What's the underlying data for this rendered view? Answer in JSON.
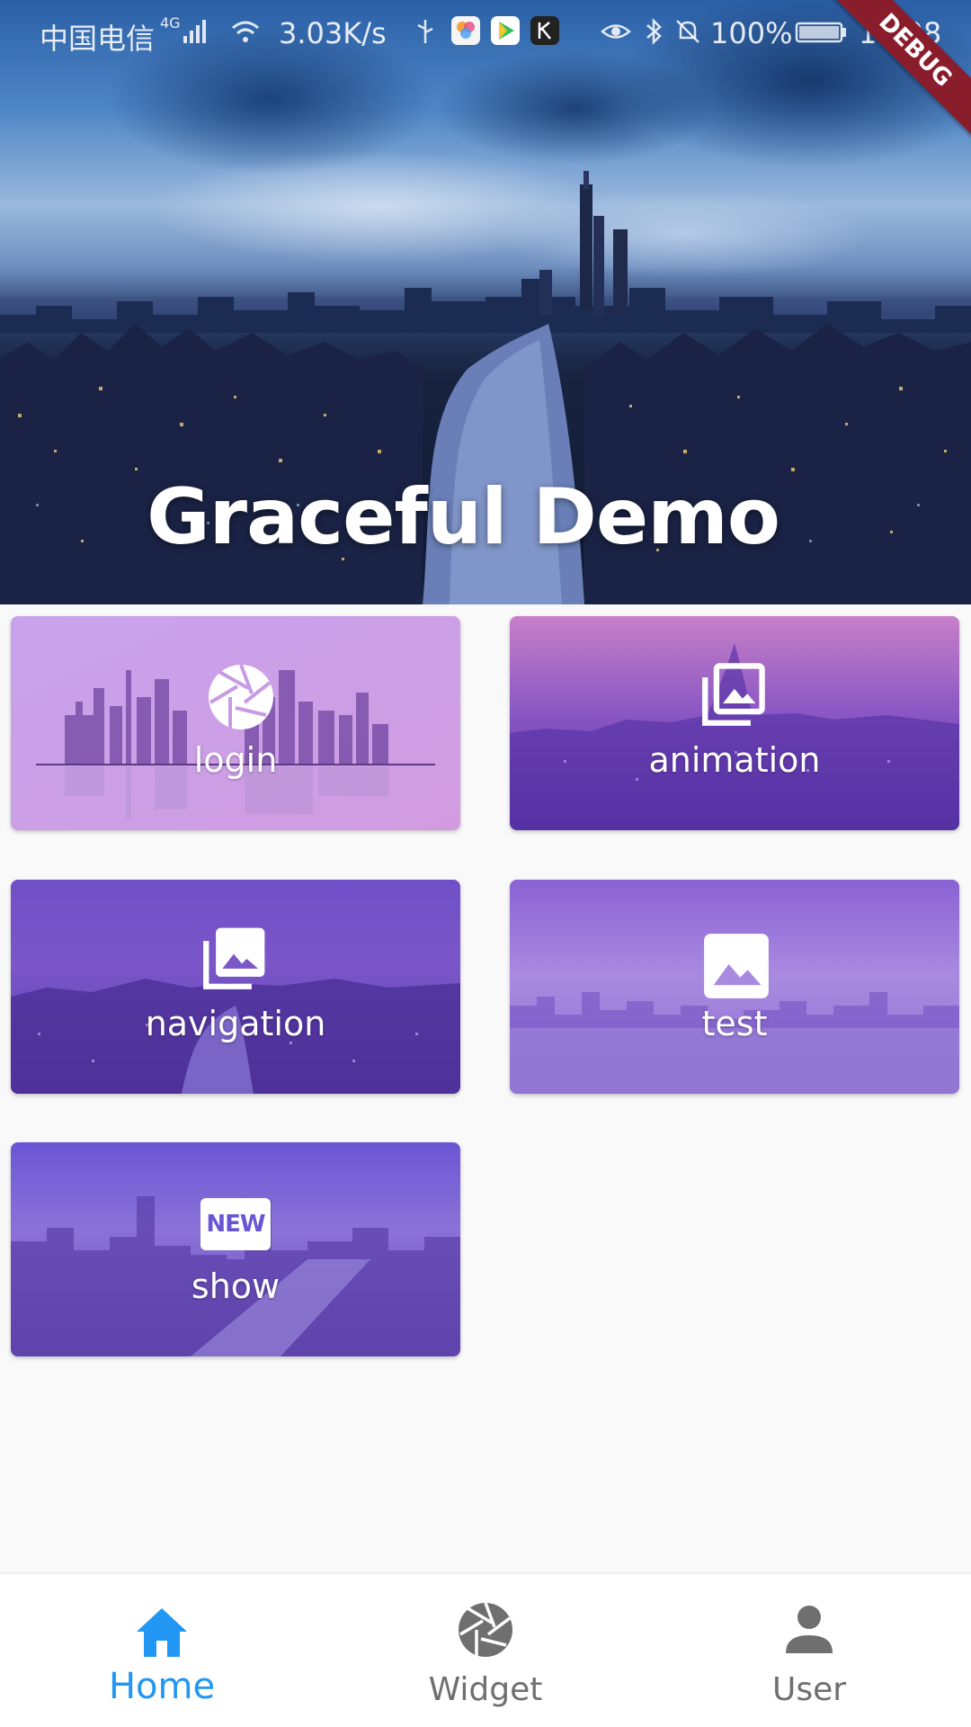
{
  "status_bar": {
    "carrier": "中国电信",
    "network": "4G",
    "speed": "3.03K/s",
    "battery": "100%",
    "time": "15:08"
  },
  "debug_banner": "DEBUG",
  "hero": {
    "title": "Graceful Demo"
  },
  "cards": [
    {
      "label": "login",
      "icon": "aperture-icon"
    },
    {
      "label": "animation",
      "icon": "photo-library-icon"
    },
    {
      "label": "navigation",
      "icon": "photo-library-icon"
    },
    {
      "label": "test",
      "icon": "image-icon"
    },
    {
      "label": "show",
      "icon": "new-badge-icon"
    }
  ],
  "new_badge_text": "NEW",
  "bottom_nav": {
    "items": [
      {
        "label": "Home",
        "icon": "home-icon",
        "active": true
      },
      {
        "label": "Widget",
        "icon": "aperture-icon",
        "active": false
      },
      {
        "label": "User",
        "icon": "person-icon",
        "active": false
      }
    ],
    "active_color": "#2196f3",
    "inactive_color": "#6f6f6f"
  }
}
